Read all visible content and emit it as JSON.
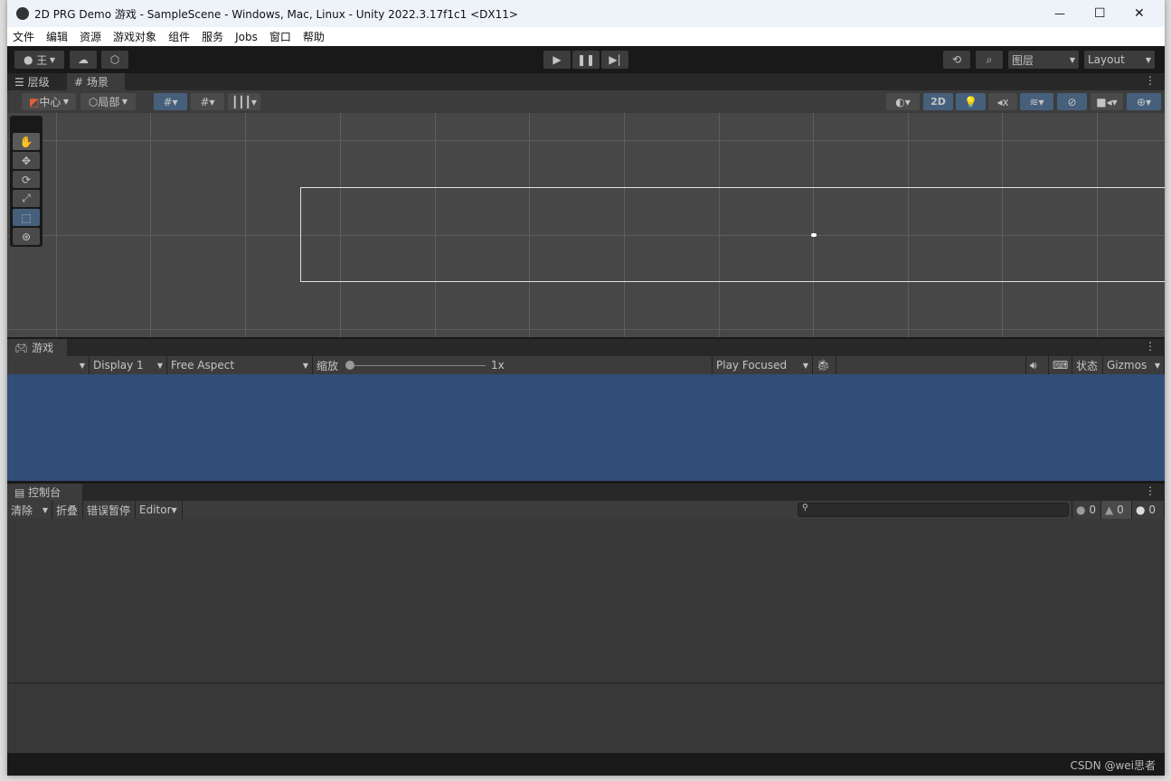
{
  "window": {
    "title": "2D PRG Demo 游戏 - SampleScene - Windows, Mac, Linux - Unity 2022.3.17f1c1 <DX11>",
    "minimize": "—",
    "maximize": "☐",
    "close": "✕"
  },
  "menu": [
    "文件",
    "编辑",
    "资源",
    "游戏对象",
    "组件",
    "服务",
    "Jobs",
    "窗口",
    "帮助"
  ],
  "toolbar": {
    "account": "王",
    "layers": "图层",
    "layout": "Layout"
  },
  "tabs": {
    "hierarchy": "层级",
    "scene": "场景",
    "game": "游戏",
    "console": "控制台"
  },
  "scene_toolbar": {
    "pivot": "中心",
    "space": "局部",
    "mode_2d": "2D"
  },
  "game_toolbar": {
    "display": "Display 1",
    "aspect": "Free Aspect",
    "scale_label": "缩放",
    "scale_value": "1x",
    "play_mode": "Play Focused",
    "stats": "状态",
    "gizmos": "Gizmos"
  },
  "console": {
    "clear": "清除",
    "collapse": "折叠",
    "error_pause": "错误暂停",
    "editor": "Editor",
    "search_placeholder": "",
    "info_count": "0",
    "warning_count": "0",
    "error_count": "0"
  },
  "colors": {
    "game_background": "#314d79",
    "active_button": "#46607c"
  },
  "watermark": "CSDN @wei思者"
}
